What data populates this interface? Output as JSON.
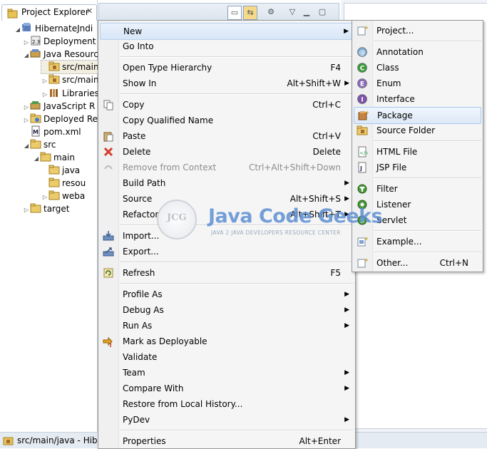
{
  "explorer": {
    "tab_label": "Project Explorer",
    "close_glyph": "✕",
    "tree": [
      {
        "label": "HibernateJndi",
        "icon": "project-icon",
        "twisty": "open"
      },
      {
        "label": "Deployment",
        "icon": "deployment-descriptor-icon",
        "twisty": "closed"
      },
      {
        "label": "Java Resources",
        "icon": "java-resources-icon",
        "twisty": "open"
      },
      {
        "label": "src/main",
        "icon": "source-folder-icon",
        "twisty": "none"
      },
      {
        "label": "src/main",
        "icon": "source-folder-icon",
        "twisty": "closed"
      },
      {
        "label": "Libraries",
        "icon": "libraries-icon",
        "twisty": "closed"
      },
      {
        "label": "JavaScript R",
        "icon": "javascript-resources-icon",
        "twisty": "closed"
      },
      {
        "label": "Deployed Re",
        "icon": "deployed-resources-icon",
        "twisty": "closed"
      },
      {
        "label": "pom.xml",
        "icon": "maven-pom-icon",
        "twisty": "none"
      },
      {
        "label": "src",
        "icon": "folder-icon",
        "twisty": "open"
      },
      {
        "label": "main",
        "icon": "folder-icon",
        "twisty": "open"
      },
      {
        "label": "java",
        "icon": "folder-icon",
        "twisty": "none"
      },
      {
        "label": "resou",
        "icon": "folder-icon",
        "twisty": "none"
      },
      {
        "label": "weba",
        "icon": "folder-icon",
        "twisty": "closed"
      },
      {
        "label": "target",
        "icon": "folder-icon",
        "twisty": "closed"
      }
    ]
  },
  "status": {
    "text": "src/main/java - Hiber"
  },
  "watermark": {
    "badge": "JCG",
    "title": "Java Code Geeks",
    "subtitle": "JAVA 2 JAVA DEVELOPERS RESOURCE CENTER"
  },
  "main_menu": {
    "items": [
      {
        "label": "New",
        "accel": "",
        "submenu": true,
        "icon": "",
        "disabled": false
      },
      {
        "label": "Go Into",
        "accel": "",
        "submenu": false,
        "icon": "",
        "disabled": false
      },
      {
        "sep": true
      },
      {
        "label": "Open Type Hierarchy",
        "accel": "F4",
        "submenu": false,
        "icon": "",
        "disabled": false
      },
      {
        "label": "Show In",
        "accel": "Alt+Shift+W",
        "submenu": true,
        "icon": "",
        "disabled": false
      },
      {
        "sep": true
      },
      {
        "label": "Copy",
        "accel": "Ctrl+C",
        "submenu": false,
        "icon": "copy-icon",
        "disabled": false
      },
      {
        "label": "Copy Qualified Name",
        "accel": "",
        "submenu": false,
        "icon": "",
        "disabled": false
      },
      {
        "label": "Paste",
        "accel": "Ctrl+V",
        "submenu": false,
        "icon": "paste-icon",
        "disabled": false
      },
      {
        "label": "Delete",
        "accel": "Delete",
        "submenu": false,
        "icon": "delete-icon",
        "disabled": false
      },
      {
        "label": "Remove from Context",
        "accel": "Ctrl+Alt+Shift+Down",
        "submenu": false,
        "icon": "remove-context-icon",
        "disabled": true
      },
      {
        "label": "Build Path",
        "accel": "",
        "submenu": true,
        "icon": "",
        "disabled": false
      },
      {
        "label": "Source",
        "accel": "Alt+Shift+S",
        "submenu": true,
        "icon": "",
        "disabled": false
      },
      {
        "label": "Refactor",
        "accel": "Alt+Shift+T",
        "submenu": true,
        "icon": "",
        "disabled": false
      },
      {
        "sep": true
      },
      {
        "label": "Import...",
        "accel": "",
        "submenu": false,
        "icon": "import-icon",
        "disabled": false
      },
      {
        "label": "Export...",
        "accel": "",
        "submenu": false,
        "icon": "export-icon",
        "disabled": false
      },
      {
        "sep": true
      },
      {
        "label": "Refresh",
        "accel": "F5",
        "submenu": false,
        "icon": "refresh-icon",
        "disabled": false
      },
      {
        "sep": true
      },
      {
        "label": "Profile As",
        "accel": "",
        "submenu": true,
        "icon": "",
        "disabled": false
      },
      {
        "label": "Debug As",
        "accel": "",
        "submenu": true,
        "icon": "",
        "disabled": false
      },
      {
        "label": "Run As",
        "accel": "",
        "submenu": true,
        "icon": "",
        "disabled": false
      },
      {
        "label": "Mark as Deployable",
        "accel": "",
        "submenu": false,
        "icon": "deployable-icon",
        "disabled": false
      },
      {
        "label": "Validate",
        "accel": "",
        "submenu": false,
        "icon": "",
        "disabled": false
      },
      {
        "label": "Team",
        "accel": "",
        "submenu": true,
        "icon": "",
        "disabled": false
      },
      {
        "label": "Compare With",
        "accel": "",
        "submenu": true,
        "icon": "",
        "disabled": false
      },
      {
        "label": "Restore from Local History...",
        "accel": "",
        "submenu": false,
        "icon": "",
        "disabled": false
      },
      {
        "label": "PyDev",
        "accel": "",
        "submenu": true,
        "icon": "",
        "disabled": false
      },
      {
        "sep": true
      },
      {
        "label": "Properties",
        "accel": "Alt+Enter",
        "submenu": false,
        "icon": "",
        "disabled": false
      }
    ]
  },
  "sub_menu": {
    "items": [
      {
        "label": "Project...",
        "accel": "",
        "icon": "new-project-icon"
      },
      {
        "sep": true
      },
      {
        "label": "Annotation",
        "accel": "",
        "icon": "annotation-icon"
      },
      {
        "label": "Class",
        "accel": "",
        "icon": "class-icon"
      },
      {
        "label": "Enum",
        "accel": "",
        "icon": "enum-icon"
      },
      {
        "label": "Interface",
        "accel": "",
        "icon": "interface-icon"
      },
      {
        "label": "Package",
        "accel": "",
        "icon": "package-icon",
        "highlight": true
      },
      {
        "label": "Source Folder",
        "accel": "",
        "icon": "source-folder-icon"
      },
      {
        "sep": true
      },
      {
        "label": "HTML File",
        "accel": "",
        "icon": "html-file-icon"
      },
      {
        "label": "JSP File",
        "accel": "",
        "icon": "jsp-file-icon"
      },
      {
        "sep": true
      },
      {
        "label": "Filter",
        "accel": "",
        "icon": "filter-icon"
      },
      {
        "label": "Listener",
        "accel": "",
        "icon": "listener-icon"
      },
      {
        "label": "Servlet",
        "accel": "",
        "icon": "servlet-icon"
      },
      {
        "sep": true
      },
      {
        "label": "Example...",
        "accel": "",
        "icon": "example-icon"
      },
      {
        "sep": true
      },
      {
        "label": "Other...",
        "accel": "Ctrl+N",
        "icon": "other-wizard-icon"
      }
    ]
  },
  "colors": {
    "menu_bg": "#f5f5f5",
    "highlight_border": "#a8c8ee",
    "watermark_blue": "#5d8fd3"
  }
}
